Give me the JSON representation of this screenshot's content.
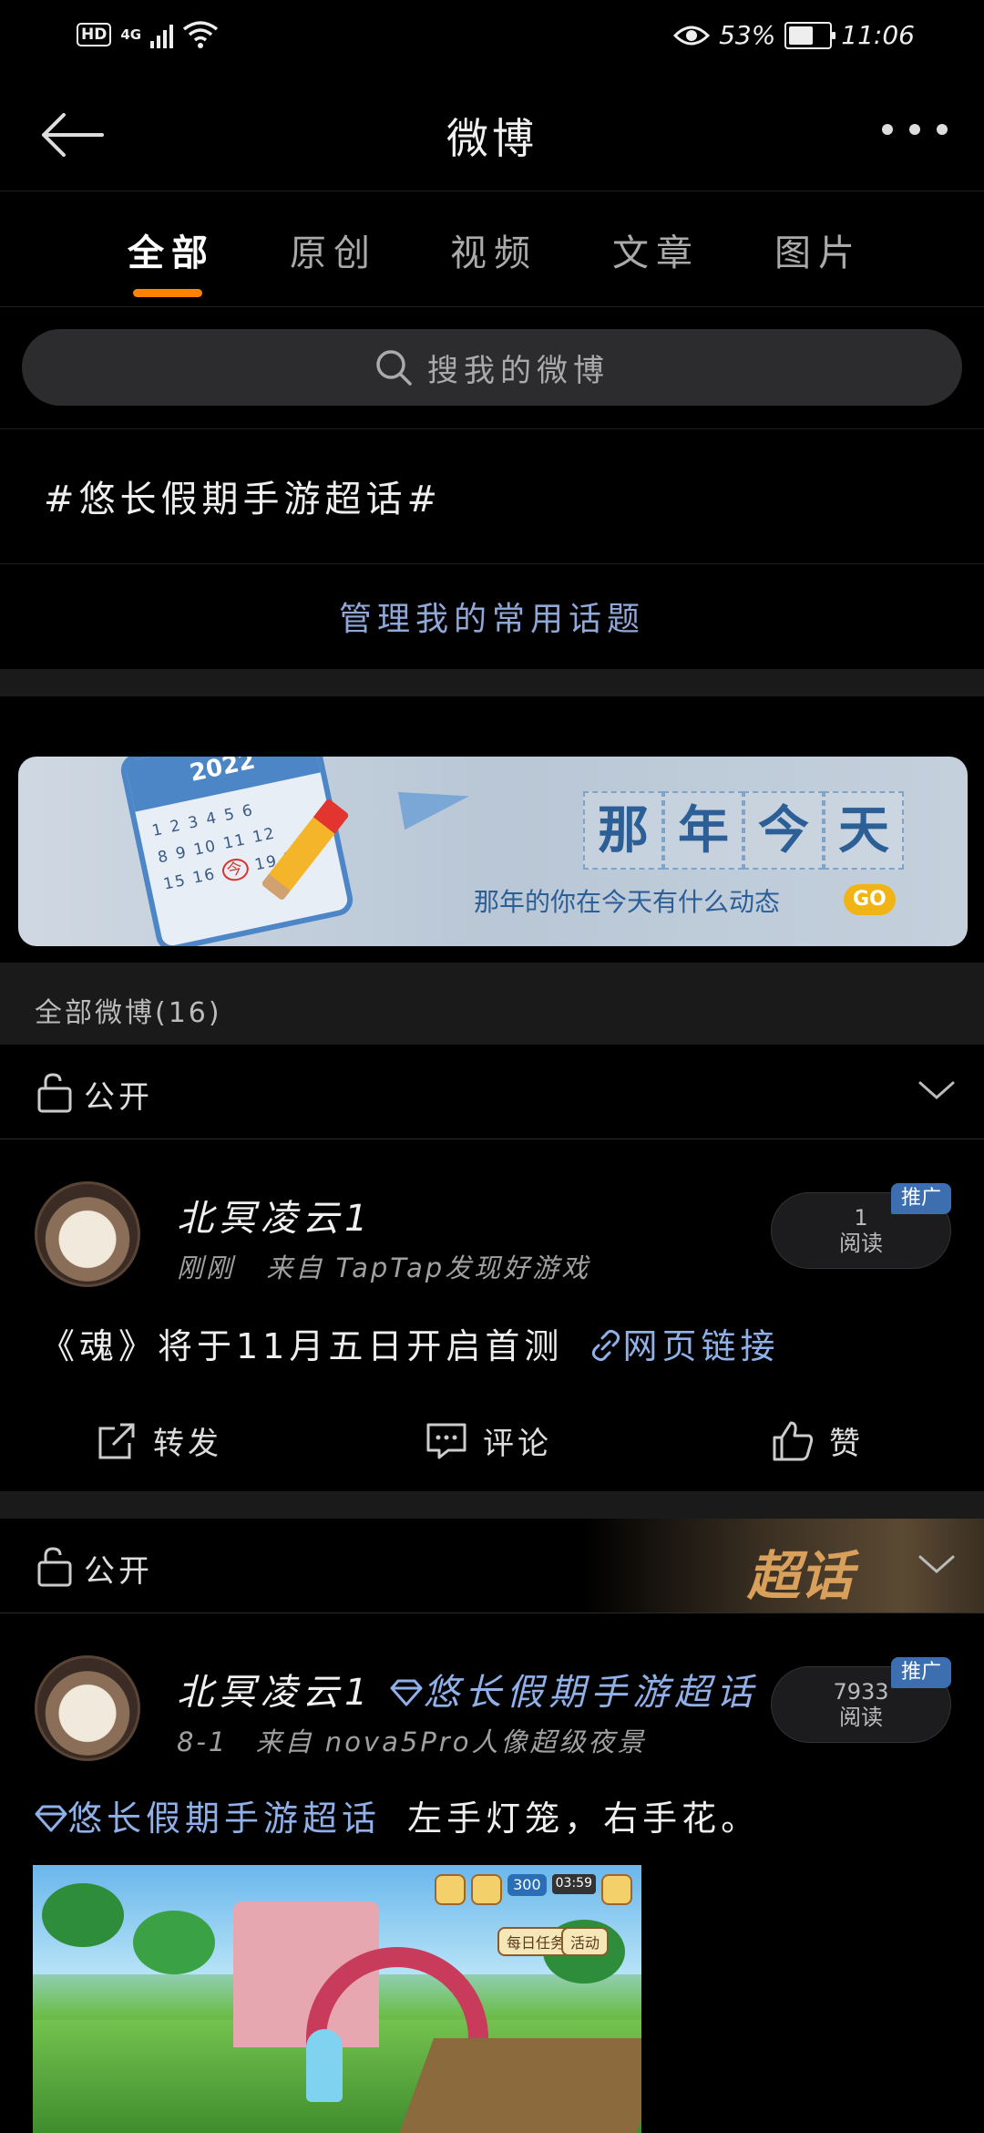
{
  "status_bar": {
    "hd": "HD",
    "network": "4G",
    "battery": "53%",
    "time": "11:06"
  },
  "header": {
    "title": "微博"
  },
  "tabs": [
    {
      "label": "全部",
      "active": true
    },
    {
      "label": "原创",
      "active": false
    },
    {
      "label": "视频",
      "active": false
    },
    {
      "label": "文章",
      "active": false
    },
    {
      "label": "图片",
      "active": false
    }
  ],
  "search": {
    "placeholder": "搜我的微博"
  },
  "topic": {
    "tag": "#悠长假期手游超话#",
    "manage_label": "管理我的常用话题"
  },
  "banner": {
    "calendar_year": "2022",
    "calendar_today": "今",
    "title_chars": [
      "那",
      "年",
      "今",
      "天"
    ],
    "subtitle": "那年的你在今天有什么动态",
    "go_label": "GO"
  },
  "feed": {
    "section_title": "全部微博(16)",
    "privacy_label": "公开",
    "super_topic_badge": "超话",
    "posts": [
      {
        "username": "北冥凌云1",
        "time": "刚刚",
        "source": "来自 TapTap发现好游戏",
        "read_count": "1",
        "read_label": "阅读",
        "promo_label": "推广",
        "text": "《魂》将于11月五日开启首测",
        "link_text": "网页链接",
        "actions": {
          "repost": "转发",
          "comment": "评论",
          "like": "赞"
        }
      },
      {
        "username": "北冥凌云1",
        "topic": "悠长假期手游超话",
        "time": "8-1",
        "source": "来自 nova5Pro人像超级夜景",
        "read_count": "7933",
        "read_label": "阅读",
        "promo_label": "推广",
        "text_topic": "悠长假期手游超话",
        "text": "左手灯笼，右手花。",
        "image_hud": {
          "coins": "300",
          "time": "03:59",
          "daily_task": "每日任务",
          "activity": "活动"
        }
      }
    ]
  },
  "colors": {
    "accent": "#ff8200",
    "link": "#8fb0e8",
    "promo": "#3d6fb0",
    "background": "#000000"
  }
}
